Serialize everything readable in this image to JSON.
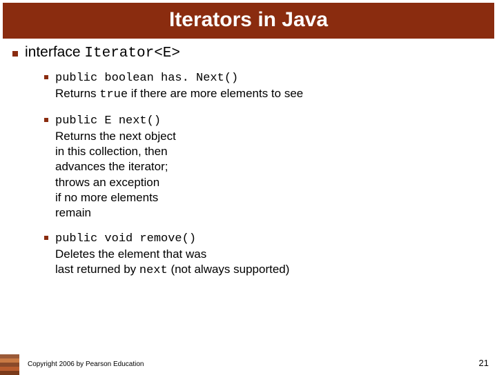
{
  "title": "Iterators in Java",
  "main": {
    "prefix": "interface ",
    "iface": "Iterator<E>"
  },
  "items": [
    {
      "sig": "public boolean has. Next()",
      "desc_pre": "Returns ",
      "desc_code": "true",
      "desc_post": " if there are more elements to see"
    },
    {
      "sig": "public E next()",
      "desc_pre": "Returns the next object\nin this collection, then\nadvances the iterator;\nthrows an exception\nif no more elements\nremain",
      "desc_code": "",
      "desc_post": ""
    },
    {
      "sig": "public void remove()",
      "desc_pre": "Deletes the element that was\nlast returned by ",
      "desc_code": "next",
      "desc_post": " (not always supported)"
    }
  ],
  "footer": {
    "copyright": "Copyright 2006 by Pearson Education",
    "page": "21"
  }
}
